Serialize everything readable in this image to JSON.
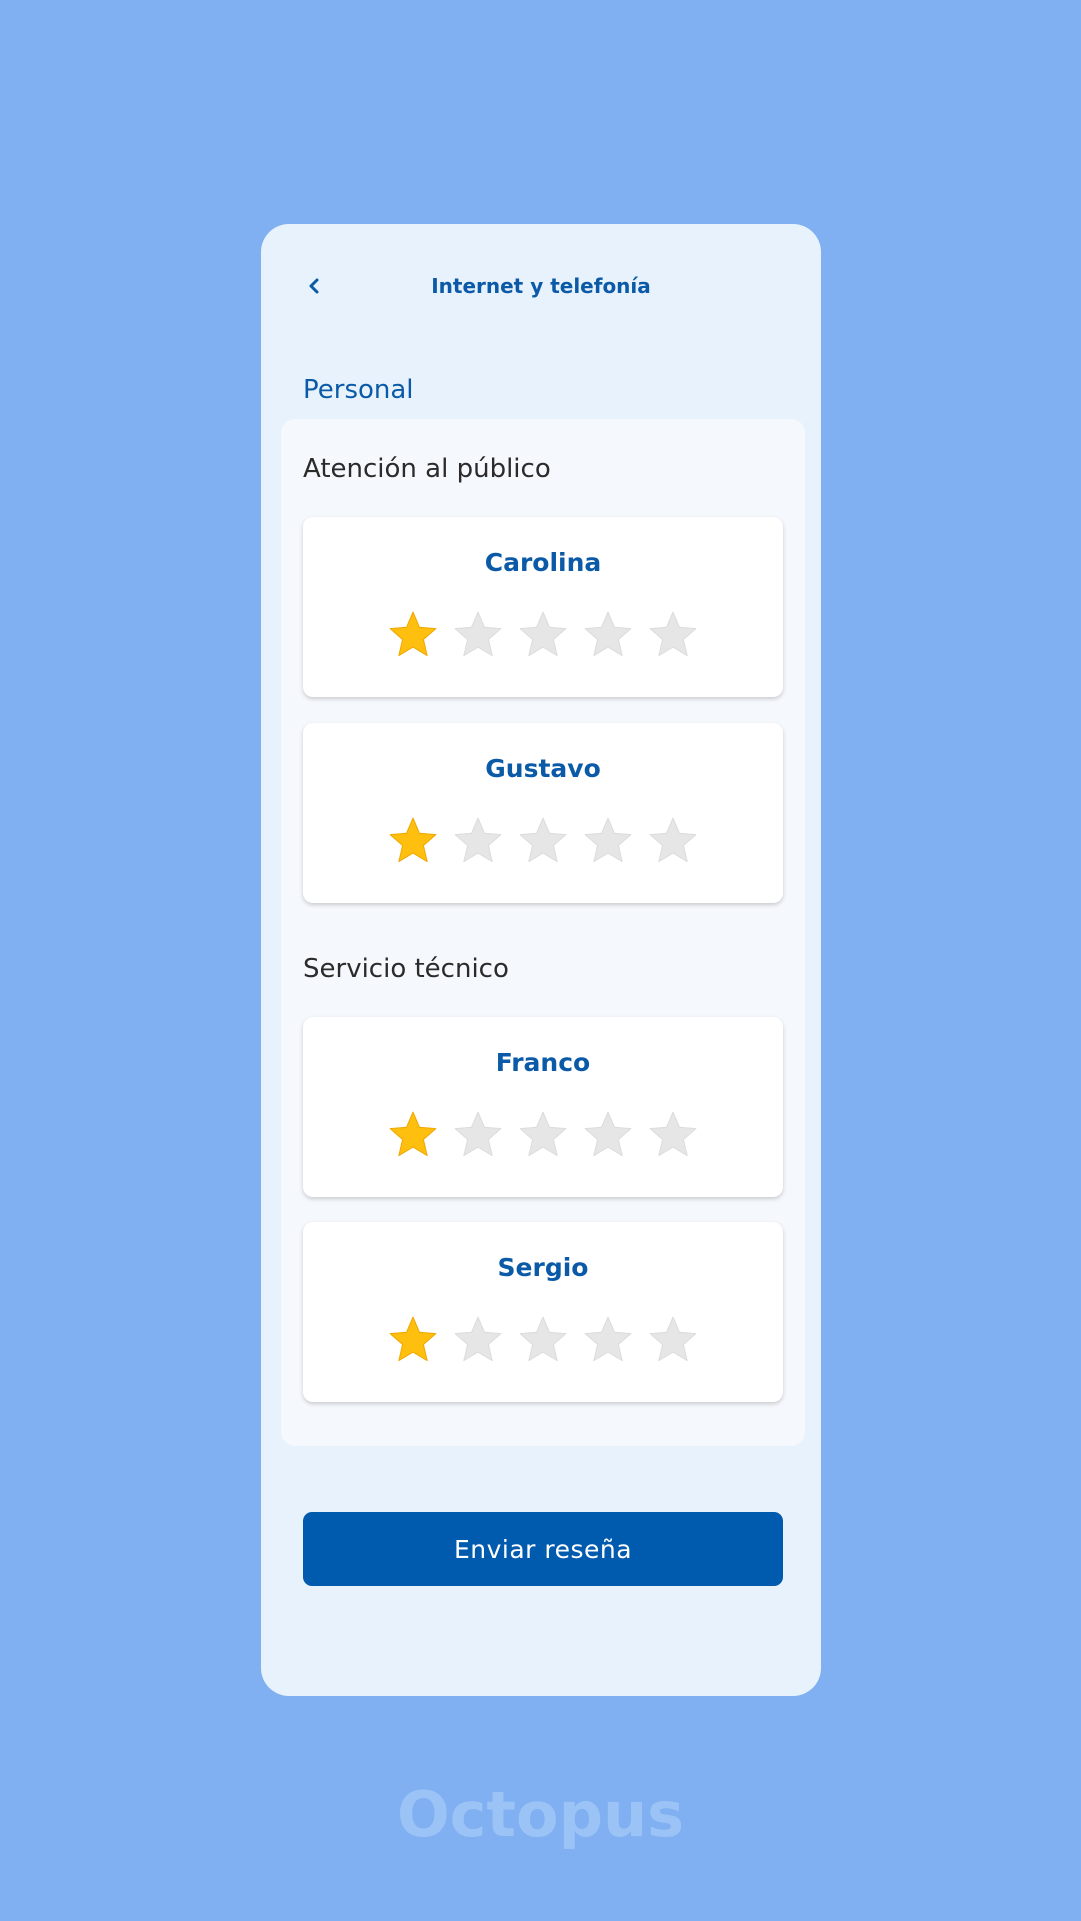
{
  "header": {
    "title": "Internet y telefonía",
    "back_icon": "chevron-left-icon"
  },
  "section": {
    "label": "Personal"
  },
  "groups": [
    {
      "title": "Atención al público",
      "people": [
        {
          "name": "Carolina",
          "rating": 1,
          "max": 5
        },
        {
          "name": "Gustavo",
          "rating": 1,
          "max": 5
        }
      ]
    },
    {
      "title": "Servicio técnico",
      "people": [
        {
          "name": "Franco",
          "rating": 1,
          "max": 5
        },
        {
          "name": "Sergio",
          "rating": 1,
          "max": 5
        }
      ]
    }
  ],
  "submit": {
    "label": "Enviar reseña"
  },
  "watermark": "Octopus",
  "colors": {
    "background": "#80b0f2",
    "accent": "#0a5aa8",
    "button": "#005aad",
    "star_filled": "#ffbf0f",
    "star_empty": "#e6e6e6"
  }
}
